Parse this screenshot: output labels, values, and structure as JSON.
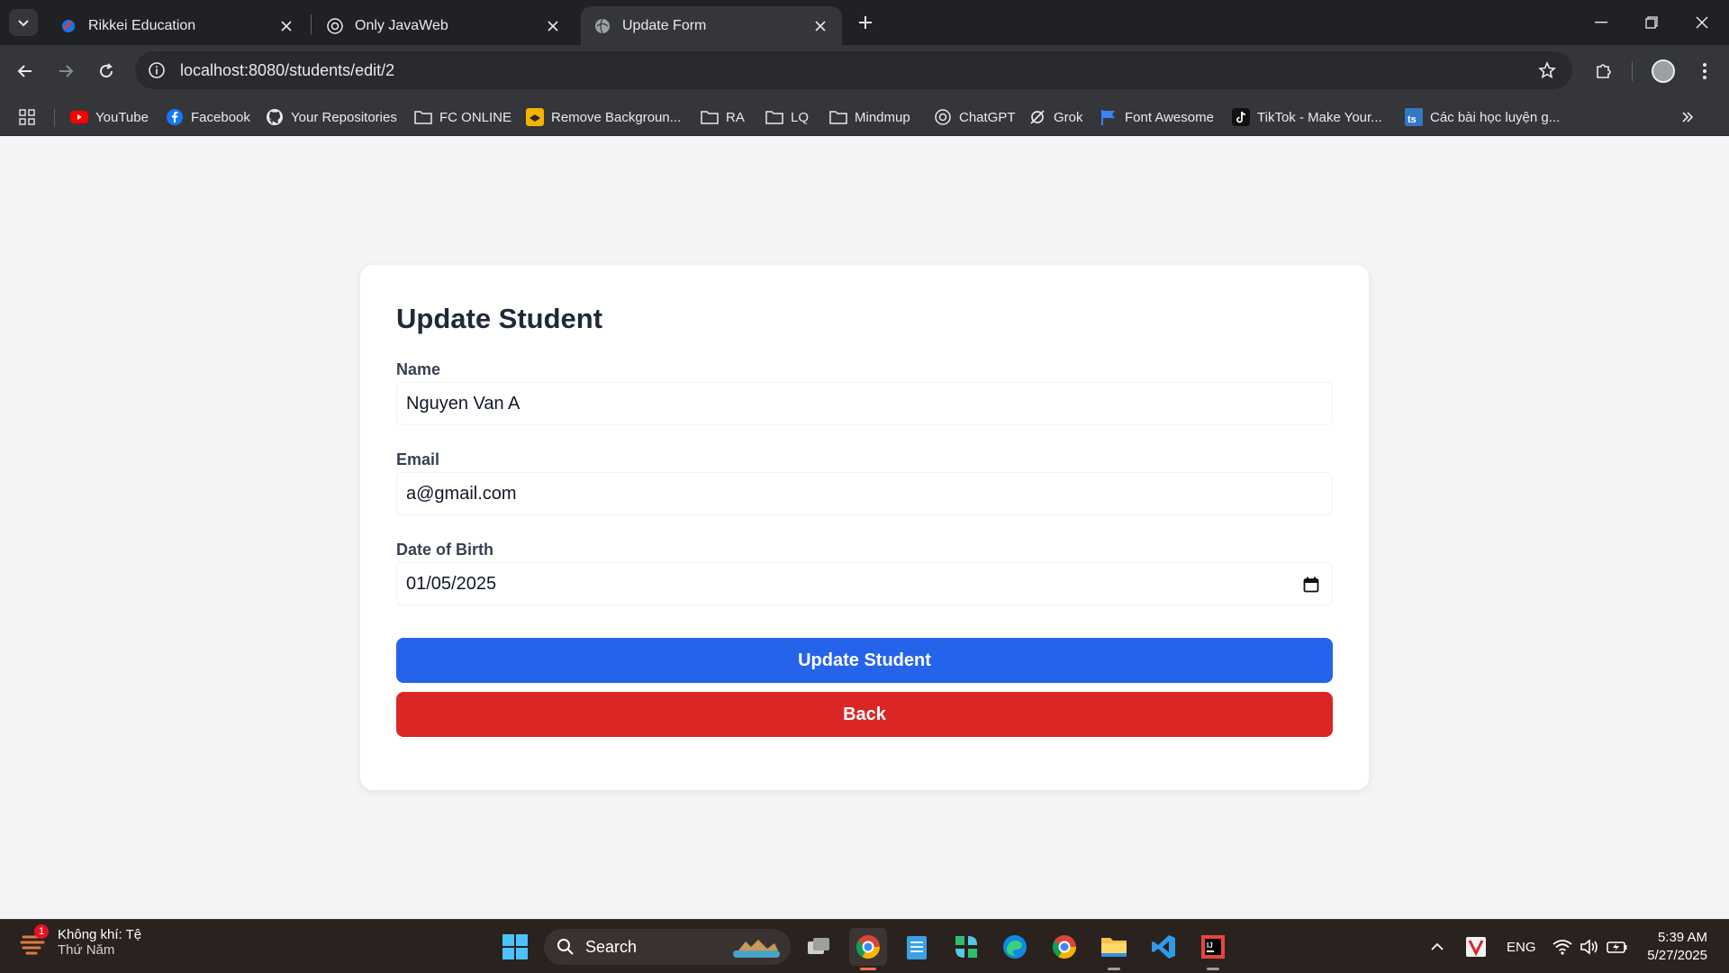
{
  "browser": {
    "tabs": [
      {
        "title": "Rikkei Education",
        "active": false
      },
      {
        "title": "Only JavaWeb",
        "active": false
      },
      {
        "title": "Update Form",
        "active": true
      }
    ],
    "url": "localhost:8080/students/edit/2",
    "bookmarks": [
      {
        "label": "YouTube",
        "icon": "youtube-icon"
      },
      {
        "label": "Facebook",
        "icon": "facebook-icon"
      },
      {
        "label": "Your Repositories",
        "icon": "github-icon"
      },
      {
        "label": "FC ONLINE",
        "icon": "folder-icon"
      },
      {
        "label": "Remove Backgroun...",
        "icon": "remove-bg-icon"
      },
      {
        "label": "RA",
        "icon": "folder-icon"
      },
      {
        "label": "LQ",
        "icon": "folder-icon"
      },
      {
        "label": "Mindmup",
        "icon": "folder-icon"
      },
      {
        "label": "ChatGPT",
        "icon": "chatgpt-icon"
      },
      {
        "label": "Grok",
        "icon": "grok-icon"
      },
      {
        "label": "Font Awesome",
        "icon": "font-awesome-icon"
      },
      {
        "label": "TikTok - Make Your...",
        "icon": "tiktok-icon"
      },
      {
        "label": "Các bài học luyện g...",
        "icon": "ts-icon"
      }
    ]
  },
  "form": {
    "title": "Update Student",
    "name_label": "Name",
    "name_value": "Nguyen Van A",
    "email_label": "Email",
    "email_value": "a@gmail.com",
    "dob_label": "Date of Birth",
    "dob_value": "01/05/2025",
    "submit_label": "Update Student",
    "back_label": "Back"
  },
  "taskbar": {
    "weather_title": "Không khí: Tệ",
    "weather_sub": "Thứ Năm",
    "weather_badge": "1",
    "search_label": "Search",
    "language": "ENG",
    "time": "5:39 AM",
    "date": "5/27/2025"
  },
  "colors": {
    "primary": "#2563eb",
    "danger": "#dc2626",
    "page_bg": "#f3f4f6"
  }
}
